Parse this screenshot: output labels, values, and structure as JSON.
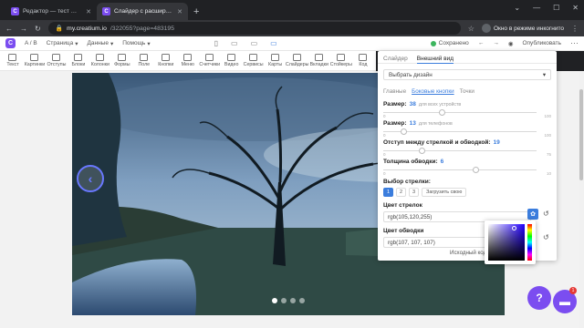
{
  "browser": {
    "tabs": [
      {
        "title": "Редактор — тест — Обучение",
        "active": false
      },
      {
        "title": "Слайдер с расширенными на…",
        "active": true
      }
    ],
    "url_host": "my.creatium.io",
    "url_path": "/322055?page=483195",
    "incognito_label": "Окно в режиме инкогнито"
  },
  "appbar": {
    "ab_label": "A / B",
    "menus": [
      "Страница",
      "Данные",
      "Помощь"
    ],
    "saved_label": "Сохранено",
    "publish_label": "Опубликовать"
  },
  "widgets": [
    "Текст",
    "Картинки",
    "Отступы",
    "Блоки",
    "Колонки",
    "Формы",
    "Поле",
    "Кнопки",
    "Меню",
    "Счетчики",
    "Видео",
    "Сервисы",
    "Карты",
    "Слайдеры",
    "Вкладки",
    "Стойкеры",
    "Код"
  ],
  "panel": {
    "tabs": [
      "Слайдер",
      "Внешний вид"
    ],
    "design_select": "Выбрать дизайн",
    "subtabs": [
      "Главные",
      "Боковые кнопки",
      "Точки"
    ],
    "size": {
      "label": "Размер:",
      "value": "38",
      "note": "для всех устройств",
      "min": "0",
      "max": "100",
      "level": 0.38
    },
    "size_mobile": {
      "label": "Размер:",
      "value": "13",
      "note": "для телефонов",
      "min": "0",
      "max": "100",
      "level": 0.13
    },
    "gap": {
      "label": "Отступ между стрелкой и обводкой:",
      "value": "19",
      "min": "0",
      "max": "75",
      "level": 0.25
    },
    "stroke": {
      "label": "Толщина обводки:",
      "value": "6",
      "min": "0",
      "max": "10",
      "level": 0.6
    },
    "arrow_choice": {
      "label": "Выбор стрелки:",
      "options": [
        "1",
        "2",
        "3"
      ],
      "upload": "Загрузить свою"
    },
    "arrow_color": {
      "label": "Цвет стрелок",
      "value": "rgb(105,120,255)"
    },
    "stroke_color": {
      "label": "Цвет обводки",
      "value": "rgb(107, 107, 107)"
    },
    "source_code": "Исходный код"
  },
  "colors": {
    "accent": "#3b7ddd",
    "brand": "#7b4df0",
    "arrow": "rgb(105,120,255)"
  },
  "floating": {
    "help": "?",
    "badge": "1"
  }
}
